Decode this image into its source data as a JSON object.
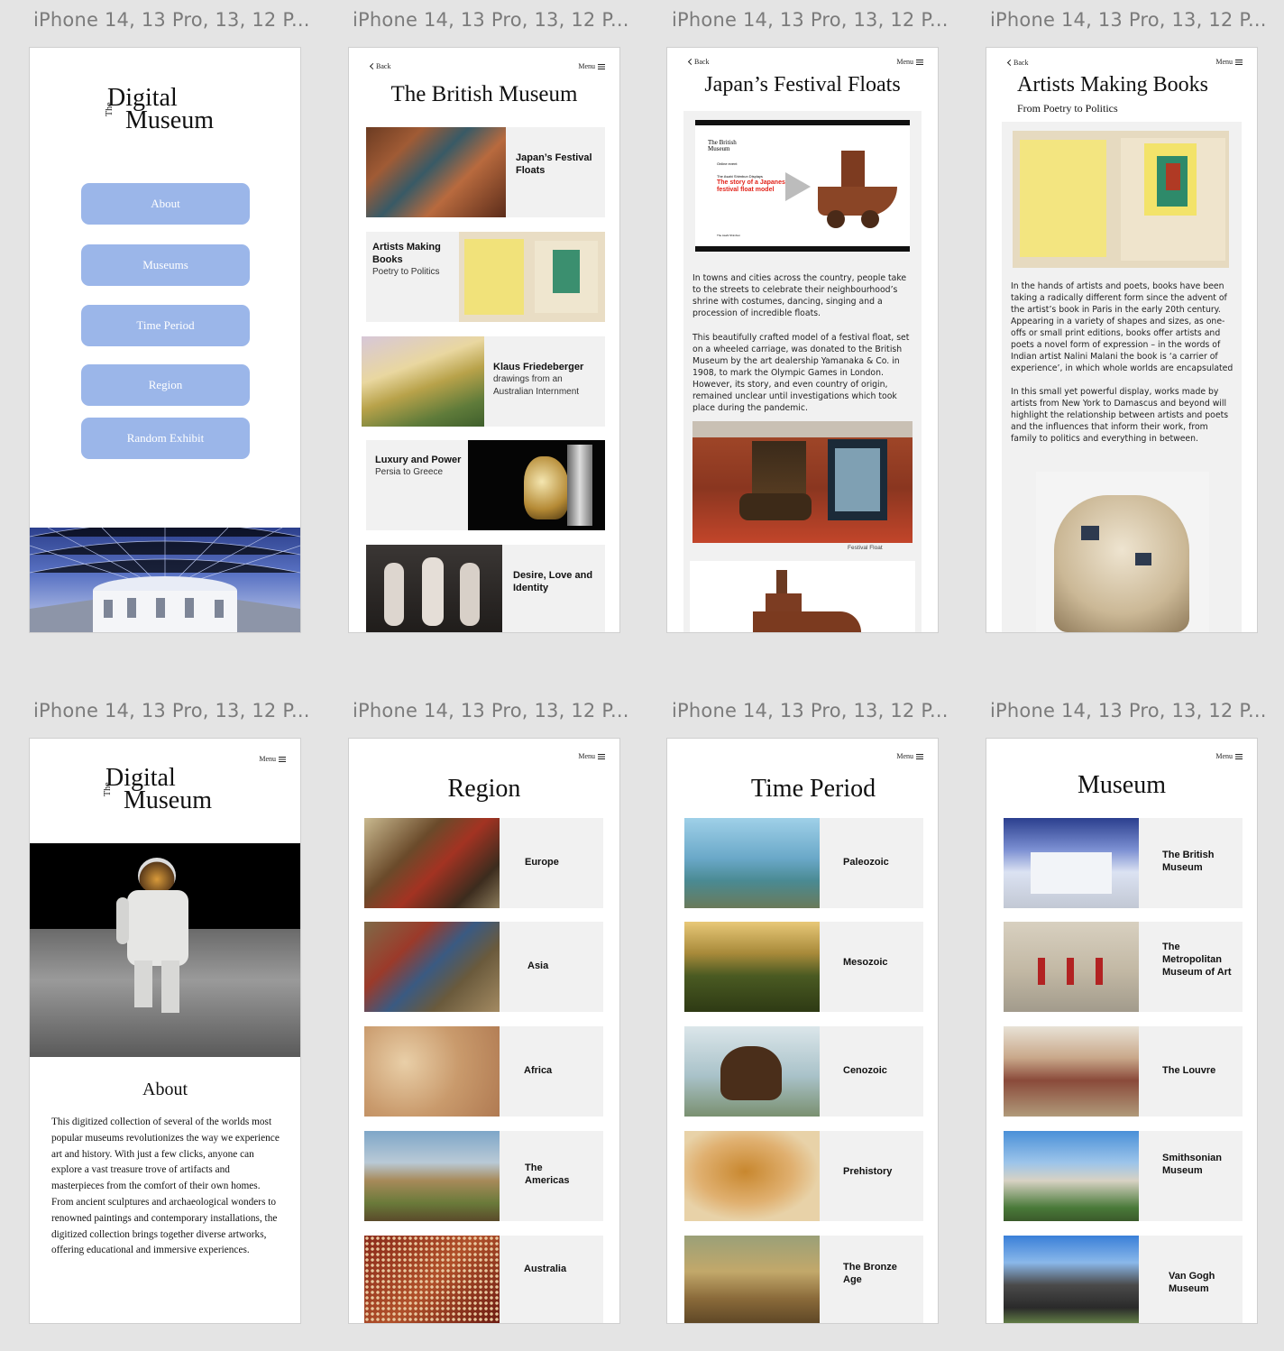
{
  "frame_title": "iPhone 14, 13 Pro, 13, 12 P...",
  "nav": {
    "back": "Back",
    "menu": "Menu"
  },
  "home": {
    "logo_line1": "Digital",
    "logo_the": "The",
    "logo_line2": "Museum",
    "buttons": [
      "About",
      "Museums",
      "Time Period",
      "Region",
      "Random Exhibit"
    ]
  },
  "british": {
    "title": "The British Museum",
    "cards": [
      {
        "title": "Japan’s Festival Floats",
        "sub": ""
      },
      {
        "title": "Artists Making Books",
        "sub": "Poetry to Politics"
      },
      {
        "title": "Klaus Friedeberger",
        "sub": "drawings from an Australian Internment"
      },
      {
        "title": "Luxury and Power",
        "sub": "Persia to Greece"
      },
      {
        "title": "Desire, Love and Identity",
        "sub": ""
      }
    ]
  },
  "japan": {
    "title": "Japan’s Festival Floats",
    "video": {
      "logo": "The British Museum",
      "small": "Online event",
      "series": "The Asahi Shimbun Displays",
      "headline": "The story of a Japanese festival float model",
      "footer": "The Asahi Shimbun"
    },
    "para1": "In towns and cities across the country, people take to the streets to celebrate their neighbourhood’s shrine with costumes, dancing, singing and a procession of incredible floats.",
    "para2": "This beautifully crafted model of a festival float, set on a wheeled carriage, was donated to the British Museum by the art dealership Yamanaka & Co. in 1908, to mark the Olympic Games in London. However, its story, and even country of origin, remained unclear until investigations which took place during the pandemic.",
    "caption": "Festival Float"
  },
  "artists": {
    "title": "Artists Making Books",
    "subtitle": "From Poetry to Politics",
    "para1": "In the hands of artists and poets, books have been taking a radically different form since the advent of the artist’s book in Paris in the early 20th century. Appearing in a variety of shapes and sizes, as one-offs or small print editions, books offer artists and poets a novel form of expression – in the words of Indian artist Nalini Malani the book is ‘a carrier of experience’, in which whole worlds are encapsulated",
    "para2": "In this small yet powerful display, works made by artists from New York to Damascus and beyond will highlight the relationship between artists and poets and the influences that inform their work, from family to politics and everything in between."
  },
  "about": {
    "title": "About",
    "text": "This digitized collection of several of the worlds most popular museums revolutionizes the way we experience art and history. With just a few clicks, anyone can explore a vast treasure trove of artifacts and masterpieces from the comfort of their own homes.  From ancient sculptures and archaeological wonders to renowned paintings and contemporary installations, the digitized collection brings together diverse artworks, offering educational and immersive experiences."
  },
  "region": {
    "title": "Region",
    "items": [
      "Europe",
      "Asia",
      "Africa",
      "The Americas",
      "Australia"
    ]
  },
  "period": {
    "title": "Time Period",
    "items": [
      "Paleozoic",
      "Mesozoic",
      "Cenozoic",
      "Prehistory",
      "The Bronze Age"
    ]
  },
  "museum": {
    "title": "Museum",
    "items": [
      "The British Museum",
      "The Metropolitan Museum of Art",
      "The Louvre",
      "Smithsonian Museum",
      "Van Gogh Museum"
    ]
  }
}
